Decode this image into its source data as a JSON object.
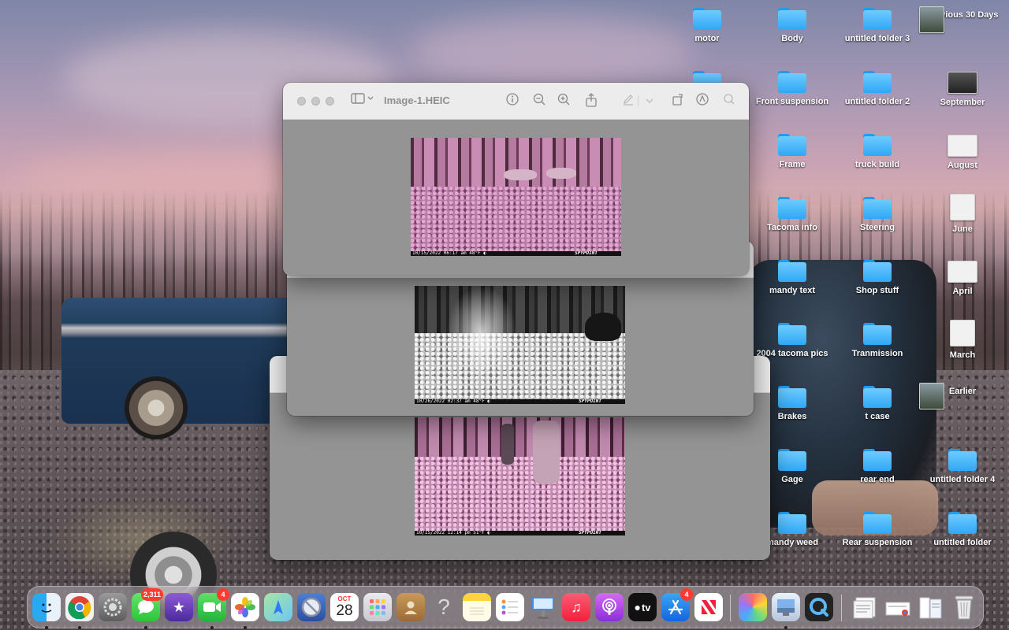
{
  "preview": {
    "window1": {
      "title": "Image-1.HEIC",
      "stamp_left": "10/15/2022 06:17 am  48°F ◐",
      "stamp_brand": "SPYPOINT"
    },
    "window2": {
      "stamp_left": "10/26/2022 02:37 am  48°F ◐",
      "stamp_brand": "SPYPOINT"
    },
    "window3": {
      "stamp_left": "10/15/2022 12:14 pm  51°F ◐",
      "stamp_brand": "SPYPOINT"
    }
  },
  "desktop": {
    "col1": [
      "motor"
    ],
    "col2": [
      "Body",
      "Front suspension",
      "Frame",
      "Tacoma info",
      "mandy text",
      "2004 tacoma pics",
      "Brakes",
      "Gage",
      "mandy weed"
    ],
    "col3": [
      "untitled folder 3",
      "untitled folder 2",
      "truck build",
      "Steering",
      "Shop stuff",
      "Tranmission",
      "t case",
      "rear end",
      "Rear suspension"
    ],
    "col4": [
      "Previous 30 Days",
      "September",
      "August",
      "June",
      "April",
      "March",
      "Earlier",
      "untitled folder 4",
      "untitled folder"
    ]
  },
  "dock": {
    "messages_badge": "2,311",
    "facetime_badge": "4",
    "calendar_month": "OCT",
    "calendar_day": "28",
    "appstore_badge": "4",
    "tv_label": "tv",
    "help_glyph": "?"
  }
}
